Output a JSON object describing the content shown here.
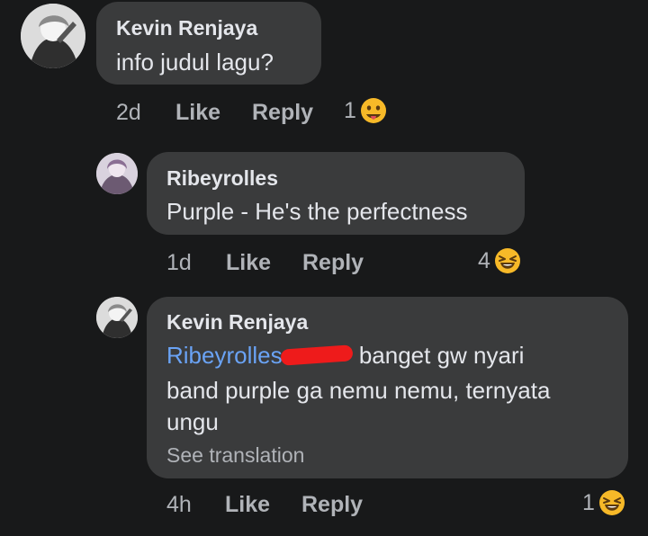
{
  "comments": [
    {
      "author": "Kevin Renjaya",
      "text": "info judul lagu?",
      "time": "2d",
      "like": "Like",
      "reply": "Reply",
      "reaction_count": "1",
      "reaction_icon": "drooling-face-emoji"
    },
    {
      "author": "Ribeyrolles",
      "text": "Purple - He's the perfectness",
      "time": "1d",
      "like": "Like",
      "reply": "Reply",
      "reaction_count": "4",
      "reaction_icon": "laughing-face-emoji"
    },
    {
      "author": "Kevin Renjaya",
      "mention": "Ribeyrolles",
      "text_line1_rest": "banget gw nyari",
      "text_line2": "band purple ga nemu nemu, ternyata",
      "text_line3": "ungu",
      "see_translation": "See translation",
      "time": "4h",
      "like": "Like",
      "reply": "Reply",
      "reaction_count": "1",
      "reaction_icon": "laughing-face-emoji"
    }
  ],
  "colors": {
    "background": "#18191a",
    "bubble": "#3a3b3c",
    "text": "#e4e6eb",
    "secondary": "#b0b3b8",
    "mention": "#6aa3f5",
    "redaction": "#ee1b1b"
  }
}
